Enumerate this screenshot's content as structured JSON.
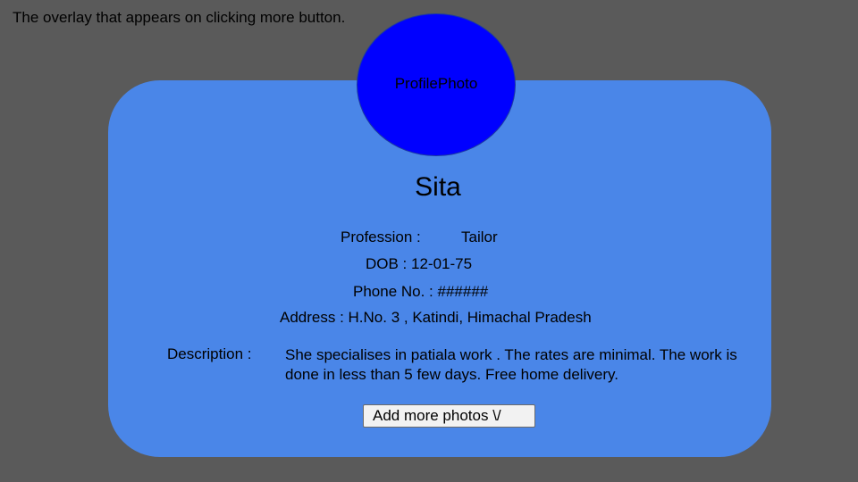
{
  "caption": "The overlay that appears on clicking more button.",
  "colors": {
    "background": "#5a5a5a",
    "card": "#4a86e8",
    "profile_photo": "#0000ff"
  },
  "profile": {
    "photo_label": "ProfilePhoto",
    "name": "Sita",
    "profession_label": "Profession :",
    "profession_value": "Tailor",
    "dob": "DOB : 12-01-75",
    "phone": "Phone No. : ######",
    "address": "Address : H.No. 3 , Katindi, Himachal Pradesh",
    "description_label": "Description :",
    "description_text": "She specialises in patiala work . The rates are minimal. The work is done in less than 5 few days. Free home delivery."
  },
  "actions": {
    "add_more_photos_label": "Add more photos \\/"
  }
}
